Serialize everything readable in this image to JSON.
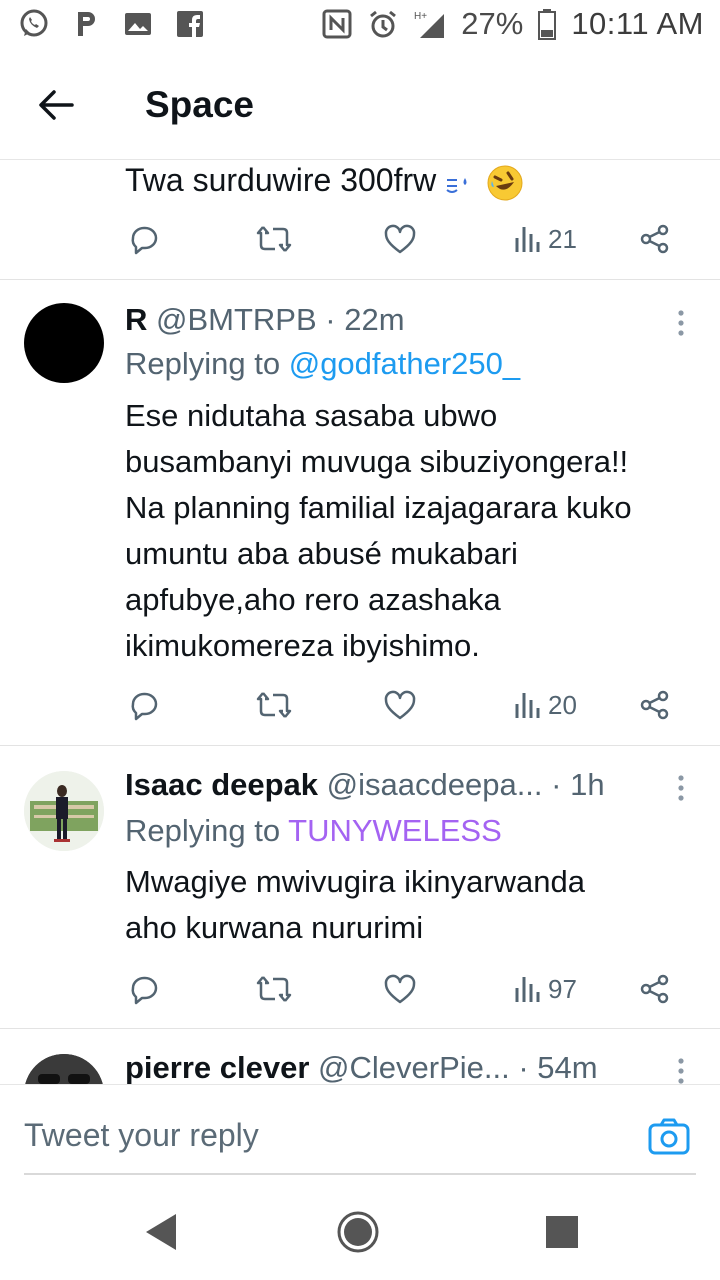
{
  "status_bar": {
    "time": "10:11 AM",
    "battery_percent": "27%",
    "network": "H+",
    "left_icons": [
      "whatsapp-icon",
      "p-icon",
      "image-icon",
      "facebook-icon"
    ],
    "right_icons": [
      "nfc-icon",
      "alarm-icon",
      "signal-icon",
      "battery-icon"
    ]
  },
  "header": {
    "title": "Space"
  },
  "partial_tweet": {
    "text": "Twa surduwire 300frw",
    "views": "21"
  },
  "tweets": [
    {
      "name": "R",
      "handle": "@BMTRPB",
      "time": "· 22m",
      "replying_prefix": "Replying to ",
      "replying_to": "@godfather250_",
      "body_lines": [
        "Ese nidutaha sasaba ubwo",
        "busambanyi muvuga sibuziyongera!!",
        "Na planning familial izajagarara kuko",
        "umuntu aba abusé mukabari",
        "apfubye,aho rero azashaka",
        "ikimukomereza ibyishimo."
      ],
      "views": "20"
    },
    {
      "name": "Isaac deepak",
      "handle": "@isaacdeepa...",
      "time": "· 1h",
      "replying_prefix": "Replying to ",
      "replying_to": "TUNYWELESS",
      "body_lines": [
        "Mwagiye mwivugira ikinyarwanda",
        "aho kurwana nururimi"
      ],
      "views": "97"
    },
    {
      "name": "pierre clever",
      "handle": "@CleverPie...",
      "time": "· 54m"
    }
  ],
  "reply_bar": {
    "placeholder": "Tweet your reply"
  },
  "colors": {
    "accent": "#1d9bf0",
    "mention_purple": "#a463f2",
    "secondary_text": "#536471",
    "primary_text": "#0f1419"
  }
}
